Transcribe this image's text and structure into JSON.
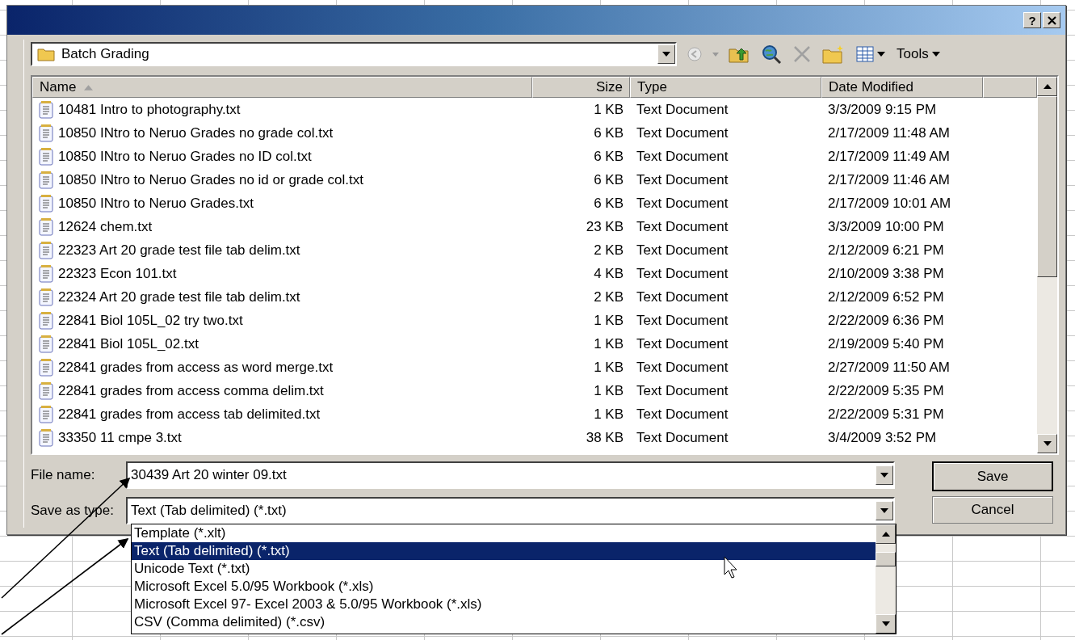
{
  "window": {
    "help_button": "?"
  },
  "location": {
    "value": "Batch Grading"
  },
  "toolbar": {
    "tools_label": "Tools"
  },
  "file_list": {
    "columns": [
      {
        "label": "Name",
        "sorted": true
      },
      {
        "label": "Size",
        "sorted": false
      },
      {
        "label": "Type",
        "sorted": false
      },
      {
        "label": "Date Modified",
        "sorted": false
      }
    ],
    "rows": [
      {
        "name": "10481 Intro to photography.txt",
        "size": "1 KB",
        "type": "Text Document",
        "date_modified": "3/3/2009 9:15 PM"
      },
      {
        "name": "10850 INtro to Neruo Grades no grade col.txt",
        "size": "6 KB",
        "type": "Text Document",
        "date_modified": "2/17/2009 11:48 AM"
      },
      {
        "name": "10850 INtro to Neruo Grades no ID col.txt",
        "size": "6 KB",
        "type": "Text Document",
        "date_modified": "2/17/2009 11:49 AM"
      },
      {
        "name": "10850 INtro to Neruo Grades no id or grade col.txt",
        "size": "6 KB",
        "type": "Text Document",
        "date_modified": "2/17/2009 11:46 AM"
      },
      {
        "name": "10850 INtro to Neruo Grades.txt",
        "size": "6 KB",
        "type": "Text Document",
        "date_modified": "2/17/2009 10:01 AM"
      },
      {
        "name": "12624 chem.txt",
        "size": "23 KB",
        "type": "Text Document",
        "date_modified": "3/3/2009 10:00 PM"
      },
      {
        "name": "22323 Art 20 grade test file tab delim.txt",
        "size": "2 KB",
        "type": "Text Document",
        "date_modified": "2/12/2009 6:21 PM"
      },
      {
        "name": "22323 Econ 101.txt",
        "size": "4 KB",
        "type": "Text Document",
        "date_modified": "2/10/2009 3:38 PM"
      },
      {
        "name": "22324 Art 20 grade test file tab delim.txt",
        "size": "2 KB",
        "type": "Text Document",
        "date_modified": "2/12/2009 6:52 PM"
      },
      {
        "name": "22841 Biol 105L_02 try two.txt",
        "size": "1 KB",
        "type": "Text Document",
        "date_modified": "2/22/2009 6:36 PM"
      },
      {
        "name": "22841 Biol 105L_02.txt",
        "size": "1 KB",
        "type": "Text Document",
        "date_modified": "2/19/2009 5:40 PM"
      },
      {
        "name": "22841 grades from access as word merge.txt",
        "size": "1 KB",
        "type": "Text Document",
        "date_modified": "2/27/2009 11:50 AM"
      },
      {
        "name": "22841 grades from access comma delim.txt",
        "size": "1 KB",
        "type": "Text Document",
        "date_modified": "2/22/2009 5:35 PM"
      },
      {
        "name": "22841 grades from access tab delimited.txt",
        "size": "1 KB",
        "type": "Text Document",
        "date_modified": "2/22/2009 5:31 PM"
      },
      {
        "name": "33350 11 cmpe 3.txt",
        "size": "38 KB",
        "type": "Text Document",
        "date_modified": "3/4/2009 3:52 PM"
      }
    ]
  },
  "file_name": {
    "label": "File name:",
    "value": "30439 Art 20 winter 09.txt"
  },
  "save_as_type": {
    "label": "Save as type:",
    "value": "Text (Tab delimited) (*.txt)",
    "expanded": true,
    "options": [
      {
        "label": "Template (*.xlt)",
        "selected": false
      },
      {
        "label": "Text (Tab delimited) (*.txt)",
        "selected": true
      },
      {
        "label": "Unicode Text (*.txt)",
        "selected": false
      },
      {
        "label": "Microsoft Excel 5.0/95 Workbook (*.xls)",
        "selected": false
      },
      {
        "label": "Microsoft Excel 97- Excel 2003 & 5.0/95 Workbook (*.xls)",
        "selected": false
      },
      {
        "label": "CSV (Comma delimited) (*.csv)",
        "selected": false
      }
    ]
  },
  "buttons": [
    {
      "label": "Save",
      "default": true
    },
    {
      "label": "Cancel",
      "default": false
    }
  ]
}
